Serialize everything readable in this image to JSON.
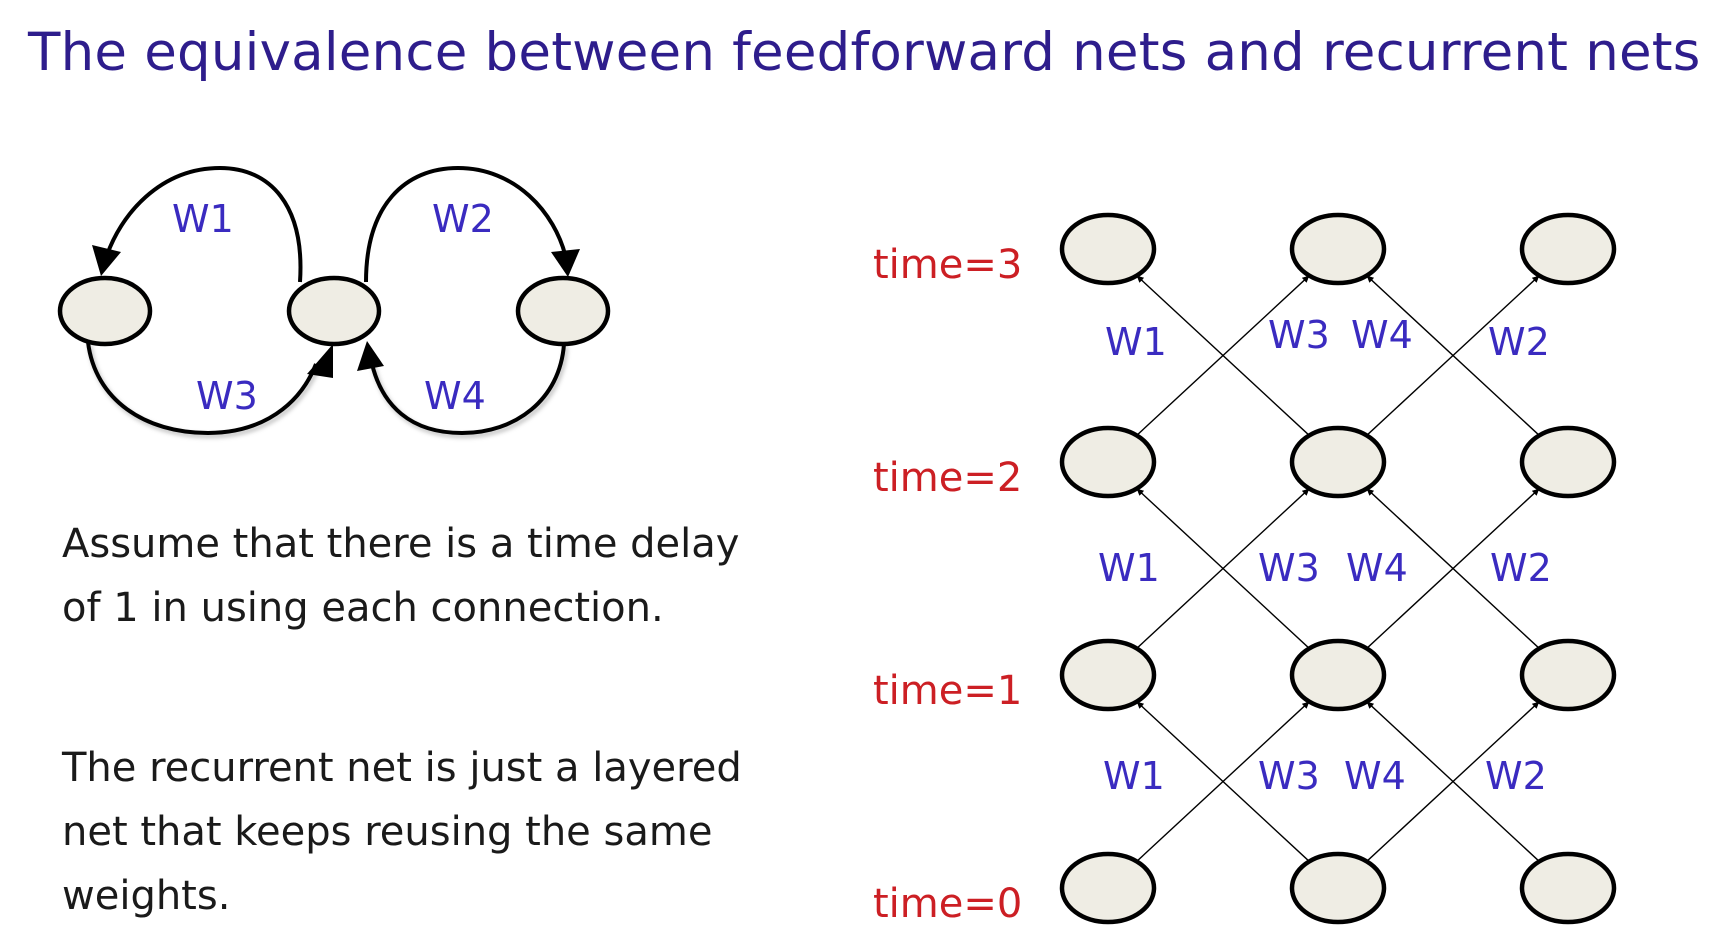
{
  "title": "The equivalence between feedforward nets and recurrent nets",
  "paragraphs": [
    "Assume that there is a time delay of 1 in using each connection.",
    "The recurrent net is just a layered net that keeps reusing the same weights."
  ],
  "recurrent_net": {
    "weights": [
      "W1",
      "W2",
      "W3",
      "W4"
    ]
  },
  "unrolled_net": {
    "time_labels": [
      "time=0",
      "time=1",
      "time=2",
      "time=3"
    ],
    "layer_weight_labels": [
      [
        "W1",
        "W3",
        "W4",
        "W2"
      ],
      [
        "W1",
        "W3",
        "W4",
        "W2"
      ],
      [
        "W1",
        "W3",
        "W4",
        "W2"
      ]
    ]
  },
  "colors": {
    "title": "#2e1d8c",
    "weight_label": "#3a2bc0",
    "time_label": "#cc1f24",
    "node_fill": "#efede4"
  }
}
